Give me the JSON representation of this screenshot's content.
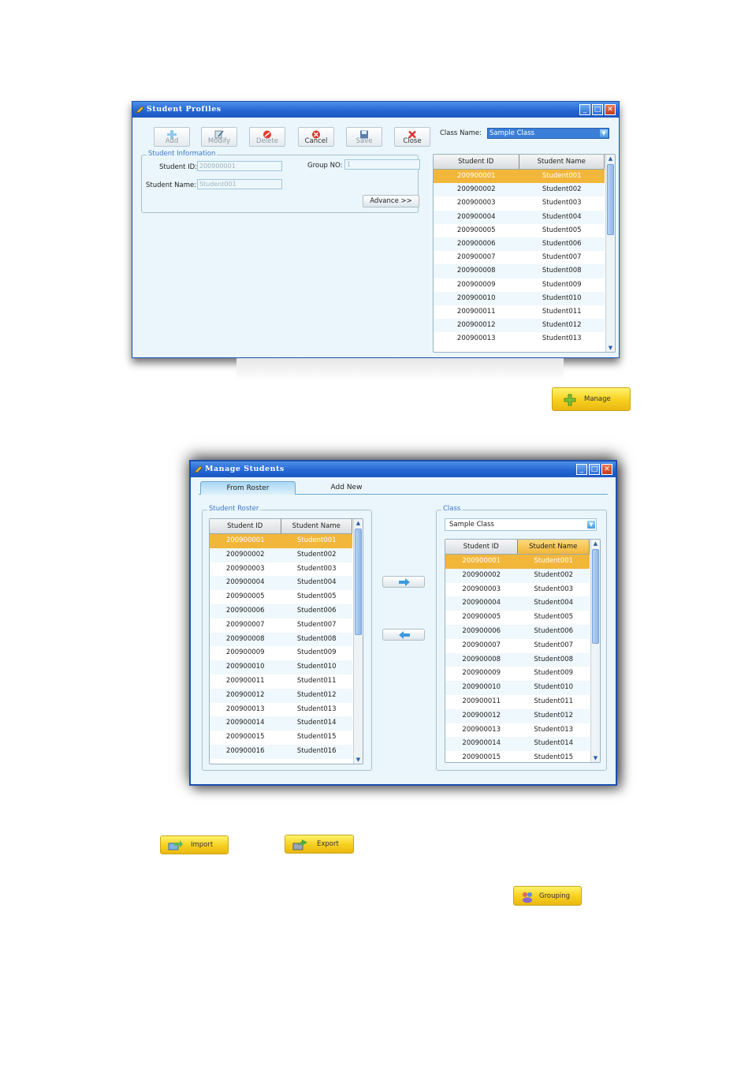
{
  "student_profiles": {
    "title": "Student Profiles",
    "toolbar": [
      {
        "label": "Add",
        "icon": "plus-icon",
        "enabled": false
      },
      {
        "label": "Modify",
        "icon": "edit-icon",
        "enabled": false
      },
      {
        "label": "Delete",
        "icon": "delete-icon",
        "enabled": false
      },
      {
        "label": "Cancel",
        "icon": "cancel-icon",
        "enabled": true
      },
      {
        "label": "Save",
        "icon": "save-icon",
        "enabled": false
      },
      {
        "label": "Close",
        "icon": "close-icon",
        "enabled": true
      }
    ],
    "class_name_label": "Class Name:",
    "class_name_value": "Sample Class",
    "info_group_title": "Student Information",
    "student_id_label": "Student ID:",
    "student_id_value": "200900001",
    "group_no_label": "Group NO:",
    "group_no_value": "1",
    "student_name_label": "Student Name:",
    "student_name_value": "Student001",
    "advance_label": "Advance >>",
    "grid": {
      "headers": [
        "Student ID",
        "Student Name"
      ],
      "rows": [
        [
          "200900001",
          "Student001"
        ],
        [
          "200900002",
          "Student002"
        ],
        [
          "200900003",
          "Student003"
        ],
        [
          "200900004",
          "Student004"
        ],
        [
          "200900005",
          "Student005"
        ],
        [
          "200900006",
          "Student006"
        ],
        [
          "200900007",
          "Student007"
        ],
        [
          "200900008",
          "Student008"
        ],
        [
          "200900009",
          "Student009"
        ],
        [
          "200900010",
          "Student010"
        ],
        [
          "200900011",
          "Student011"
        ],
        [
          "200900012",
          "Student012"
        ],
        [
          "200900013",
          "Student013"
        ]
      ],
      "selected_index": 0
    }
  },
  "manage_button": {
    "label": "Manage",
    "icon": "plus-icon"
  },
  "manage_students": {
    "title": "Manage Students",
    "tabs": [
      "From Roster",
      "Add New"
    ],
    "active_tab": 0,
    "roster_group_title": "Student Roster",
    "class_group_title": "Class",
    "class_value": "Sample Class",
    "roster_grid": {
      "headers": [
        "Student ID",
        "Student Name"
      ],
      "rows": [
        [
          "200900001",
          "Student001"
        ],
        [
          "200900002",
          "Student002"
        ],
        [
          "200900003",
          "Student003"
        ],
        [
          "200900004",
          "Student004"
        ],
        [
          "200900005",
          "Student005"
        ],
        [
          "200900006",
          "Student006"
        ],
        [
          "200900007",
          "Student007"
        ],
        [
          "200900008",
          "Student008"
        ],
        [
          "200900009",
          "Student009"
        ],
        [
          "200900010",
          "Student010"
        ],
        [
          "200900011",
          "Student011"
        ],
        [
          "200900012",
          "Student012"
        ],
        [
          "200900013",
          "Student013"
        ],
        [
          "200900014",
          "Student014"
        ],
        [
          "200900015",
          "Student015"
        ],
        [
          "200900016",
          "Student016"
        ]
      ],
      "selected_index": 0
    },
    "class_grid": {
      "headers": [
        "Student ID",
        "Student Name"
      ],
      "rows": [
        [
          "200900001",
          "Student001"
        ],
        [
          "200900002",
          "Student002"
        ],
        [
          "200900003",
          "Student003"
        ],
        [
          "200900004",
          "Student004"
        ],
        [
          "200900005",
          "Student005"
        ],
        [
          "200900006",
          "Student006"
        ],
        [
          "200900007",
          "Student007"
        ],
        [
          "200900008",
          "Student008"
        ],
        [
          "200900009",
          "Student009"
        ],
        [
          "200900010",
          "Student010"
        ],
        [
          "200900011",
          "Student011"
        ],
        [
          "200900012",
          "Student012"
        ],
        [
          "200900013",
          "Student013"
        ],
        [
          "200900014",
          "Student014"
        ],
        [
          "200900015",
          "Student015"
        ]
      ],
      "selected_index": 0
    },
    "move_right_icon": "arrow-right-icon",
    "move_left_icon": "arrow-left-icon"
  },
  "import_button": {
    "label": "Import",
    "icon": "import-icon"
  },
  "export_button": {
    "label": "Export",
    "icon": "export-icon"
  },
  "grouping_button": {
    "label": "Grouping",
    "icon": "grouping-icon"
  },
  "colors": {
    "accent": "#2467d4",
    "selected_row": "#f2b63a",
    "window_bg": "#eaf6fb",
    "yellow_button": "#f6cf1e"
  }
}
